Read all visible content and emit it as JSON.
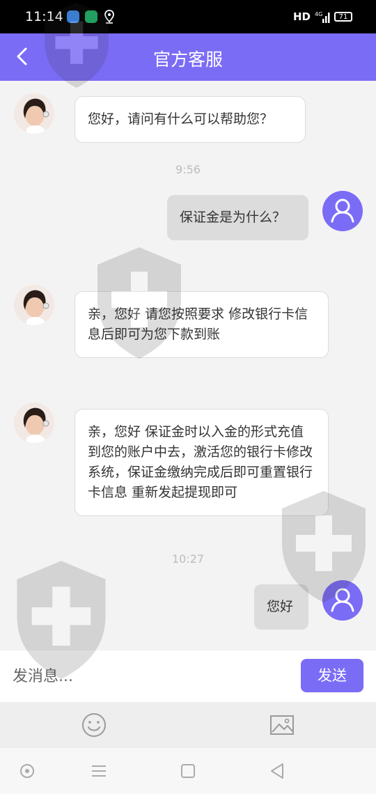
{
  "status_bar": {
    "time": "11:14",
    "network": "HD",
    "signal": "4G",
    "battery": "71"
  },
  "header": {
    "title": "官方客服",
    "back_icon": "chevron-left-icon"
  },
  "colors": {
    "accent": "#7b6cf6",
    "chat_bg": "#f3f3f3",
    "agent_bubble": "#ffffff",
    "user_bubble": "#dcdcdc"
  },
  "messages": [
    {
      "from": "agent",
      "text": "您好，请问有什么可以帮助您？"
    },
    {
      "type": "time",
      "text": "9:56"
    },
    {
      "from": "user",
      "text": "保证金是为什么？"
    },
    {
      "from": "agent",
      "text": "亲，您好 请您按照要求 修改银行卡信息后即可为您下款到账"
    },
    {
      "from": "agent",
      "text": "亲，您好 保证金时以入金的形式充值到您的账户中去，激活您的银行卡修改系统，保证金缴纳完成后即可重置银行卡信息 重新发起提现即可"
    },
    {
      "type": "time",
      "text": "10:27"
    },
    {
      "from": "user",
      "text": "您好"
    }
  ],
  "composer": {
    "placeholder": "发消息...",
    "send_label": "发送"
  },
  "toolbar": {
    "emoji_icon": "smiley-icon",
    "image_icon": "image-icon"
  },
  "system_nav": [
    "circle-icon",
    "menu-icon",
    "square-icon",
    "back-triangle-icon"
  ]
}
